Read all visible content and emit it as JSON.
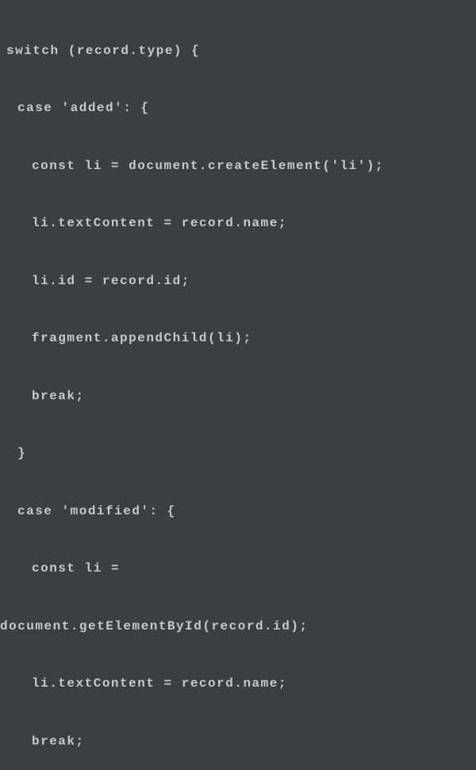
{
  "code": {
    "l1": "switch (record.type) {",
    "l2": "case 'added': {",
    "l3": "const li = document.createElement('li');",
    "l4": "li.textContent = record.name;",
    "l5": "li.id = record.id;",
    "l6": "fragment.appendChild(li);",
    "l7": "break;",
    "l8": "}",
    "l9": "case 'modified': {",
    "l10": "const li =",
    "l11": "document.getElementById(record.id);",
    "l12": "li.textContent = record.name;",
    "l13": "break;"
  }
}
